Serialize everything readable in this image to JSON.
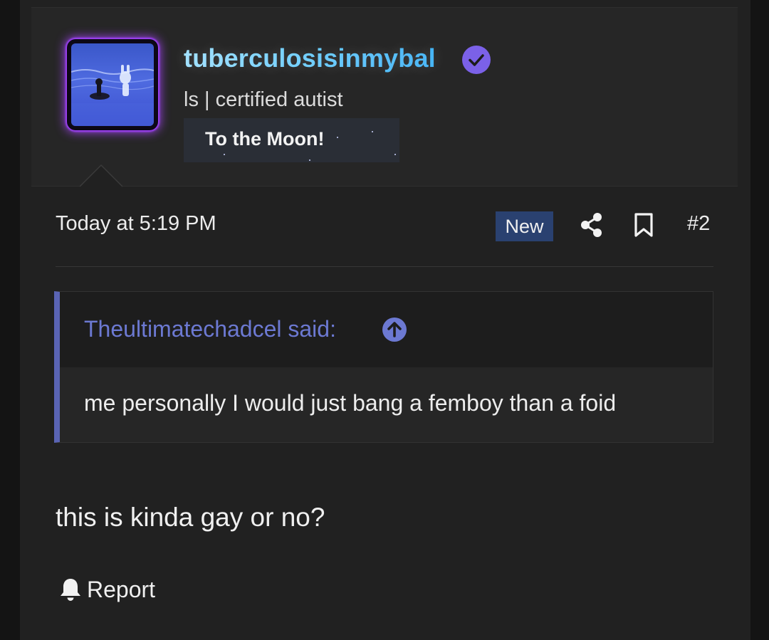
{
  "author": {
    "username": "tuberculosisinmybal",
    "title": "ls | certified autist",
    "banner": "To the Moon!",
    "verified_icon": "verified-check-icon",
    "avatar_glow_color": "#9b3dff"
  },
  "post": {
    "date": "Today at 5:19 PM",
    "badge": "New",
    "share_icon": "share-icon",
    "bookmark_icon": "bookmark-icon",
    "number": "#2"
  },
  "quote": {
    "author_line": "Theultimatechadcel said:",
    "jump_icon": "arrow-up-circle-icon",
    "text": "me personally I would just bang a femboy than a foid"
  },
  "reply_text": "this is kinda gay or no?",
  "actions": {
    "report_label": "Report",
    "report_icon": "bell-icon"
  },
  "colors": {
    "background": "#212121",
    "accent_quote": "#5a64b4",
    "new_badge": "#2a4170",
    "username_gradient_start": "#9fe0ff",
    "username_gradient_end": "#3fb2f5",
    "verified": "#7b61e8"
  }
}
